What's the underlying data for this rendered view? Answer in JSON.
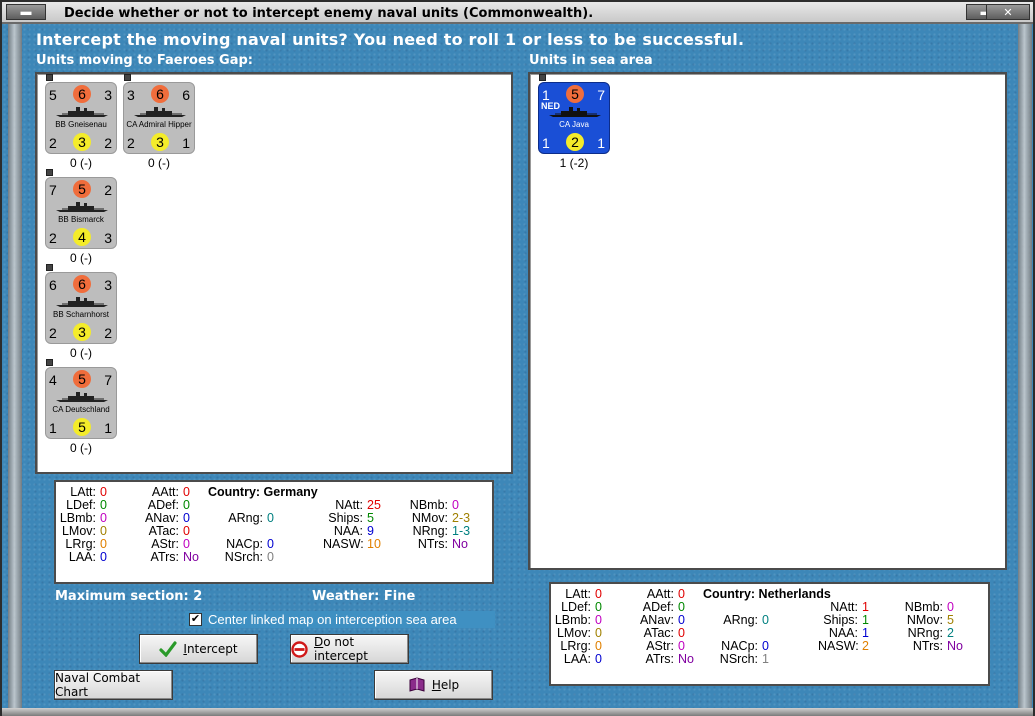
{
  "window": {
    "title": "Decide whether or not to intercept enemy naval units (Commonwealth).",
    "minimize_glyph": "▬",
    "close_glyph": "✕"
  },
  "heading": "Intercept the moving naval units?  You need to roll 1 or less to be successful.",
  "left_panel": {
    "label": "Units moving to Faeroes Gap:",
    "units": [
      {
        "tl": "5",
        "top": "6",
        "tr": "3",
        "name": "BB Gneisenau",
        "bl": "2",
        "bot": "3",
        "br": "2",
        "label": "0 (-)"
      },
      {
        "tl": "3",
        "top": "6",
        "tr": "6",
        "name": "CA Admiral Hipper",
        "bl": "2",
        "bot": "3",
        "br": "1",
        "label": "0 (-)"
      },
      {
        "tl": "7",
        "top": "5",
        "tr": "2",
        "name": "BB Bismarck",
        "bl": "2",
        "bot": "4",
        "br": "3",
        "label": "0 (-)"
      },
      {
        "tl": "6",
        "top": "6",
        "tr": "3",
        "name": "BB Scharnhorst",
        "bl": "2",
        "bot": "3",
        "br": "2",
        "label": "0 (-)"
      },
      {
        "tl": "4",
        "top": "5",
        "tr": "7",
        "name": "CA Deutschland",
        "bl": "1",
        "bot": "5",
        "br": "1",
        "label": "0 (-)"
      }
    ]
  },
  "right_panel": {
    "label": "Units in sea area",
    "units": [
      {
        "flag": "NED",
        "tl": "1",
        "top": "5",
        "tr": "7",
        "name": "CA Java",
        "bl": "1",
        "bot": "2",
        "br": "1",
        "label": "1 (-2)"
      }
    ]
  },
  "stats_germany": {
    "country": "Country: Germany",
    "LAtt": "0",
    "LDef": "0",
    "LBmb": "0",
    "LMov": "0",
    "LRrg": "0",
    "LAA": "0",
    "AAtt": "0",
    "ADef": "0",
    "ANav": "0",
    "ATac": "0",
    "AStr": "0",
    "ATrs": "No",
    "ARng": "0",
    "NACp": "0",
    "NSrch": "0",
    "NAtt": "25",
    "Ships": "5",
    "NAA": "9",
    "NASW": "10",
    "NBmb": "0",
    "NMov": "2-3",
    "NRng": "1-3",
    "NTrs": "No"
  },
  "stats_netherlands": {
    "country": "Country: Netherlands",
    "LAtt": "0",
    "LDef": "0",
    "LBmb": "0",
    "LMov": "0",
    "LRrg": "0",
    "LAA": "0",
    "AAtt": "0",
    "ADef": "0",
    "ANav": "0",
    "ATac": "0",
    "AStr": "0",
    "ATrs": "No",
    "ARng": "0",
    "NACp": "0",
    "NSrch": "1",
    "NAtt": "1",
    "Ships": "1",
    "NAA": "1",
    "NASW": "2",
    "NBmb": "0",
    "NMov": "5",
    "NRng": "2",
    "NTrs": "No"
  },
  "labels": {
    "LAtt": "LAtt:",
    "LDef": "LDef:",
    "LBmb": "LBmb:",
    "LMov": "LMov:",
    "LRrg": "LRrg:",
    "LAA": "LAA:",
    "AAtt": "AAtt:",
    "ADef": "ADef:",
    "ANav": "ANav:",
    "ATac": "ATac:",
    "AStr": "AStr:",
    "ATrs": "ATrs:",
    "ARng": "ARng:",
    "NACp": "NACp:",
    "NSrch": "NSrch:",
    "NAtt": "NAtt:",
    "Ships": "Ships:",
    "NAA": "NAA:",
    "NASW": "NASW:",
    "NBmb": "NBmb:",
    "NMov": "NMov:",
    "NRng": "NRng:",
    "NTrs": "NTrs:"
  },
  "info": {
    "max_section": "Maximum section: 2",
    "weather": "Weather:  Fine"
  },
  "center_map_checkbox": {
    "label": "Center linked map on interception sea area",
    "checked": true,
    "check_glyph": "✔"
  },
  "buttons": {
    "intercept_prefix": "",
    "intercept_underline": "I",
    "intercept_rest": "ntercept",
    "no_intercept_underline": "D",
    "no_intercept_rest": "o not intercept",
    "naval_combat_chart": "Naval Combat Chart",
    "help_underline": "H",
    "help_rest": "elp"
  },
  "icons": {
    "intercept": "check-mark-icon",
    "no_intercept": "prohibited-icon",
    "help": "book-icon"
  },
  "colors": {
    "background": "#3d87b8",
    "counter_grey": "#bdbdbd",
    "counter_blue": "#1a4fd6",
    "attack_circle": "#f06d3c",
    "defense_circle": "#f4ec2a"
  }
}
